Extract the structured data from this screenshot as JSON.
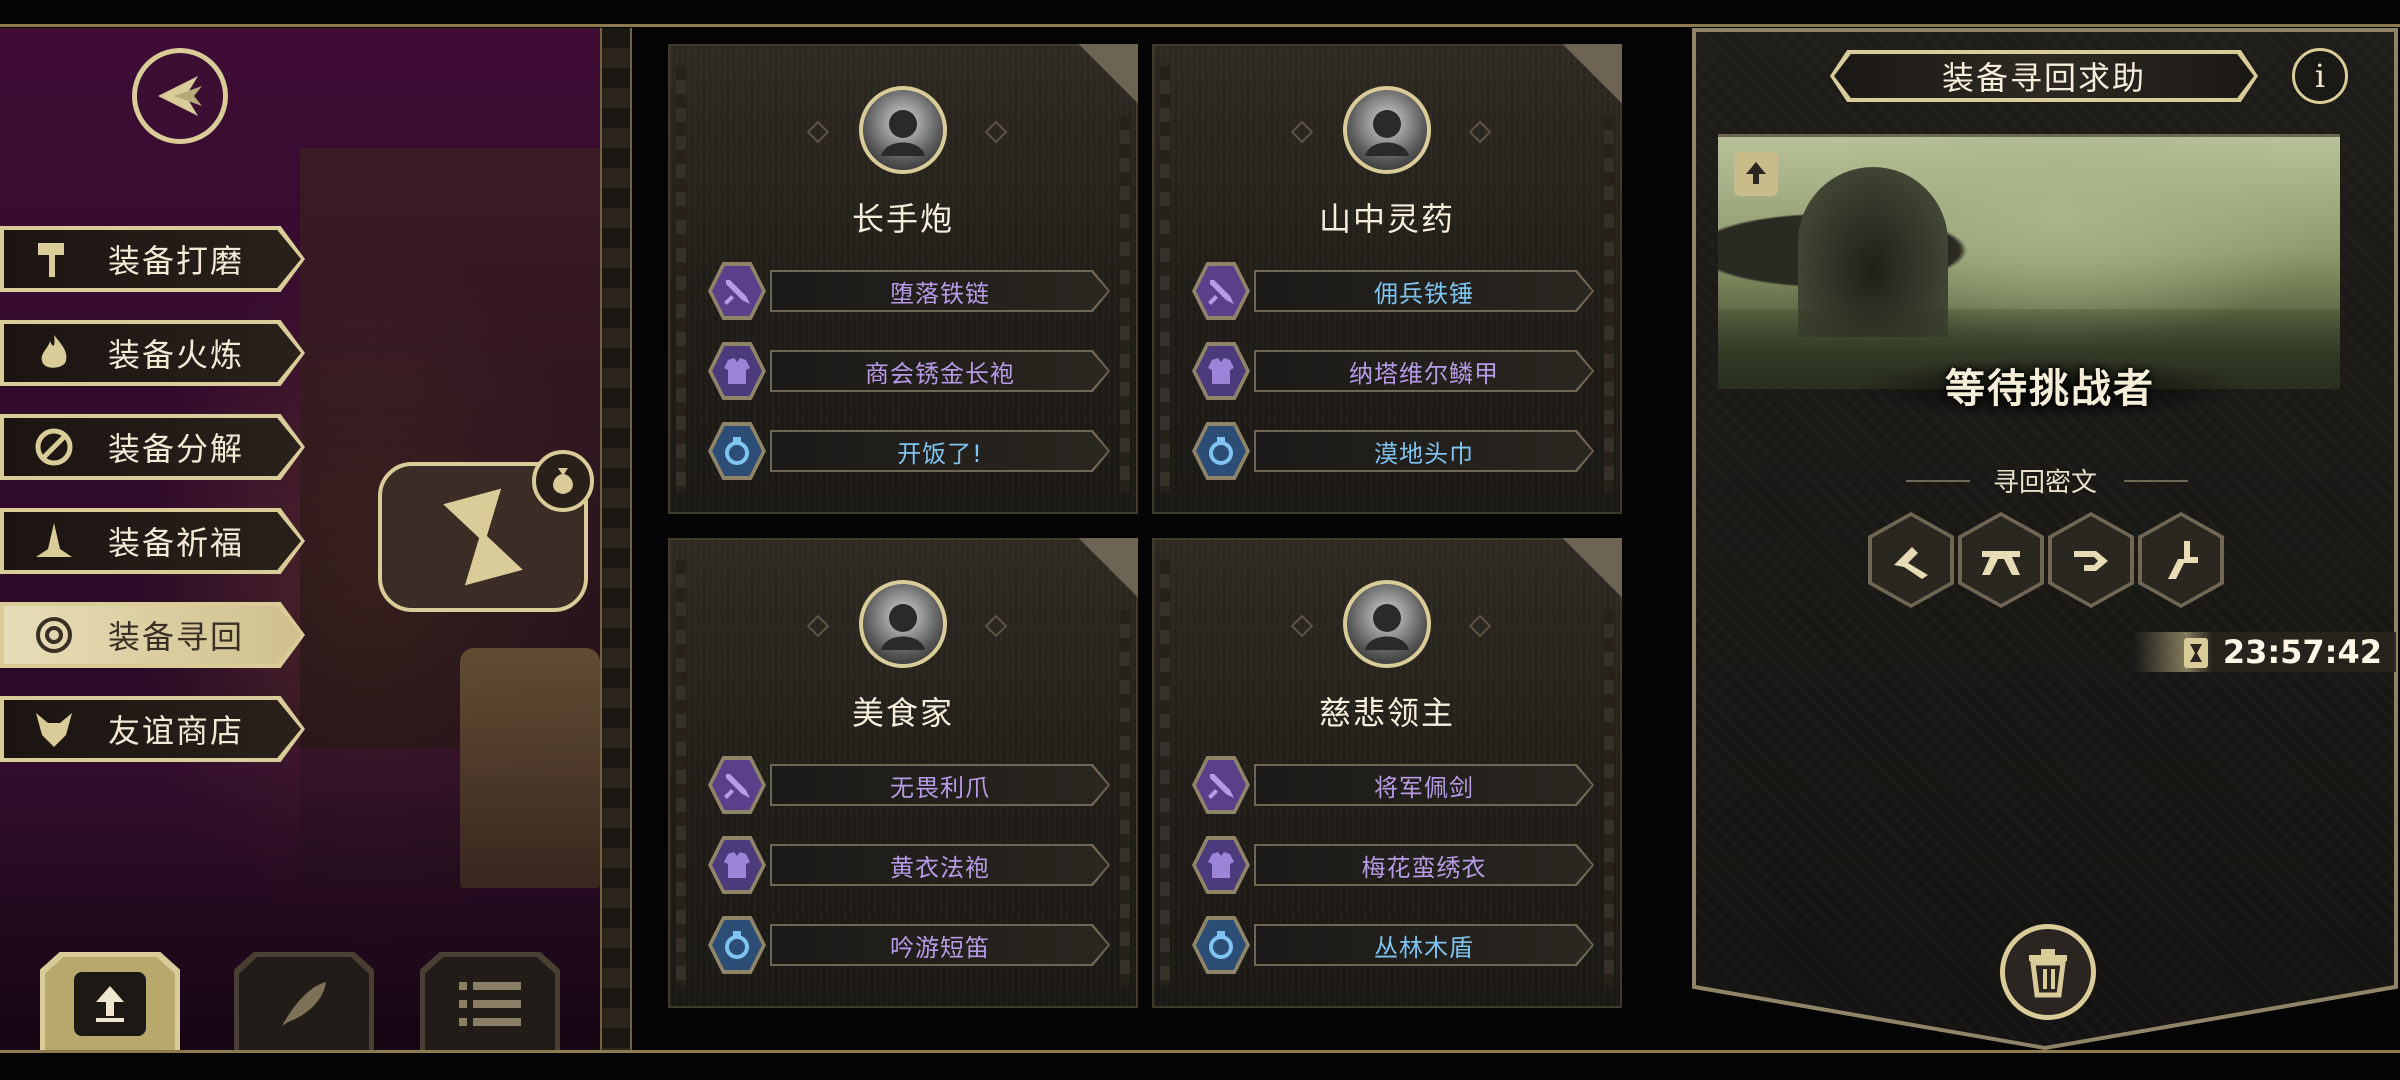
{
  "sidebar": {
    "items": [
      {
        "label": "装备打磨",
        "icon": "hammer-icon"
      },
      {
        "label": "装备火炼",
        "icon": "flame-icon"
      },
      {
        "label": "装备分解",
        "icon": "disassemble-icon"
      },
      {
        "label": "装备祈福",
        "icon": "pray-hands-icon"
      },
      {
        "label": "装备寻回",
        "icon": "target-icon",
        "active": true
      },
      {
        "label": "友谊商店",
        "icon": "fox-head-icon"
      }
    ]
  },
  "bottom_buttons": [
    {
      "icon": "upload-arrow-icon"
    },
    {
      "icon": "feather-icon"
    },
    {
      "icon": "list-icon"
    }
  ],
  "cards": [
    {
      "name": "长手炮",
      "items": [
        {
          "label": "堕落铁链",
          "type": "weapon",
          "color": "#b79be6"
        },
        {
          "label": "商会锈金长袍",
          "type": "armor",
          "color": "#b79be6"
        },
        {
          "label": "开饭了!",
          "type": "accessory",
          "color": "#7fc4f0"
        }
      ]
    },
    {
      "name": "山中灵药",
      "items": [
        {
          "label": "佣兵铁锤",
          "type": "weapon",
          "color": "#7fc4f0"
        },
        {
          "label": "纳塔维尔鳞甲",
          "type": "armor",
          "color": "#b79be6"
        },
        {
          "label": "漠地头巾",
          "type": "accessory",
          "color": "#7fc4f0"
        }
      ]
    },
    {
      "name": "美食家",
      "items": [
        {
          "label": "无畏利爪",
          "type": "weapon",
          "color": "#b79be6"
        },
        {
          "label": "黄衣法袍",
          "type": "armor",
          "color": "#b79be6"
        },
        {
          "label": "吟游短笛",
          "type": "accessory",
          "color": "#b79be6"
        }
      ]
    },
    {
      "name": "慈悲领主",
      "items": [
        {
          "label": "将军佩剑",
          "type": "weapon",
          "color": "#b79be6"
        },
        {
          "label": "梅花蛮绣衣",
          "type": "armor",
          "color": "#b79be6"
        },
        {
          "label": "丛林木盾",
          "type": "accessory",
          "color": "#7fc4f0"
        }
      ]
    }
  ],
  "right_panel": {
    "title": "装备寻回求助",
    "status": "等待挑战者",
    "cipher_label": "寻回密文",
    "timer": "23:57:42",
    "info": "i"
  },
  "colors": {
    "gold": "#d9cc98",
    "purple_bg": "#3f0c35",
    "epic": "#b79be6",
    "rare": "#7fc4f0"
  }
}
